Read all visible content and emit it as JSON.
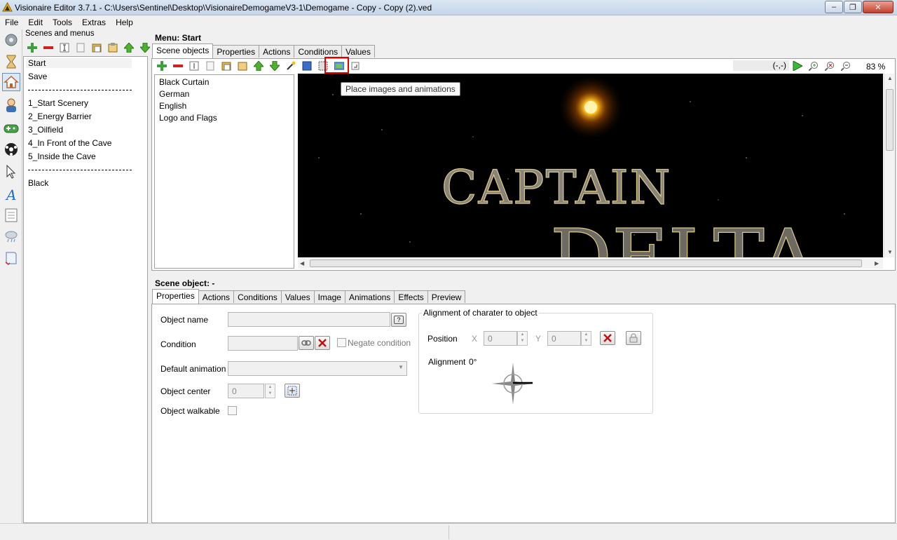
{
  "window": {
    "title": "Visionaire Editor 3.7.1 - C:\\Users\\Sentinel\\Desktop\\VisionaireDemogameV3-1\\Demogame - Copy - Copy (2).ved",
    "minimize": "–",
    "maximize": "❐",
    "close": "✕"
  },
  "menubar": {
    "items": [
      "File",
      "Edit",
      "Tools",
      "Extras",
      "Help"
    ]
  },
  "iconbar": {
    "icons": [
      "settings-icon",
      "hourglass-icon",
      "home-scenes-icon",
      "character-icon",
      "gamepad-icon",
      "ball-icon",
      "pointer-icon",
      "font-icon",
      "text-icon",
      "weather-icon",
      "script-icon"
    ]
  },
  "scenes": {
    "header": "Scenes and menus",
    "items": [
      {
        "label": "Start",
        "selected": true
      },
      {
        "label": "Save"
      },
      {
        "separator": true
      },
      {
        "label": "1_Start Scenery"
      },
      {
        "label": "2_Energy Barrier"
      },
      {
        "label": "3_Oilfield"
      },
      {
        "label": "4_In Front of the Cave"
      },
      {
        "label": "5_Inside the Cave"
      },
      {
        "separator": true
      },
      {
        "label": "Black"
      }
    ]
  },
  "menu": {
    "label": "Menu: Start",
    "tabs": [
      "Scene objects",
      "Properties",
      "Actions",
      "Conditions",
      "Values"
    ],
    "active_tab": "Scene objects"
  },
  "scene_objects": [
    "Black Curtain",
    "German",
    "English",
    "Logo and Flags"
  ],
  "canvas": {
    "coords": "(-,-)",
    "zoom": "83 %",
    "tooltip": "Place images and animations",
    "logo_line1": "CAPTAIN",
    "logo_line2": "DELTA"
  },
  "scene_object": {
    "label": "Scene object: -",
    "tabs": [
      "Properties",
      "Actions",
      "Conditions",
      "Values",
      "Image",
      "Animations",
      "Effects",
      "Preview"
    ],
    "active_tab": "Properties",
    "object_name_label": "Object name",
    "help_button": "?",
    "condition_label": "Condition",
    "negate_condition": "Negate condition",
    "default_animation_label": "Default animation",
    "object_center_label": "Object center",
    "object_center_value": "0",
    "object_walkable_label": "Object walkable",
    "alignment": {
      "group_title": "Alignment of charater to object",
      "position_label": "Position",
      "x_label": "X",
      "x_value": "0",
      "y_label": "Y",
      "y_value": "0",
      "alignment_label": "Alignment",
      "alignment_value": "0°"
    }
  }
}
